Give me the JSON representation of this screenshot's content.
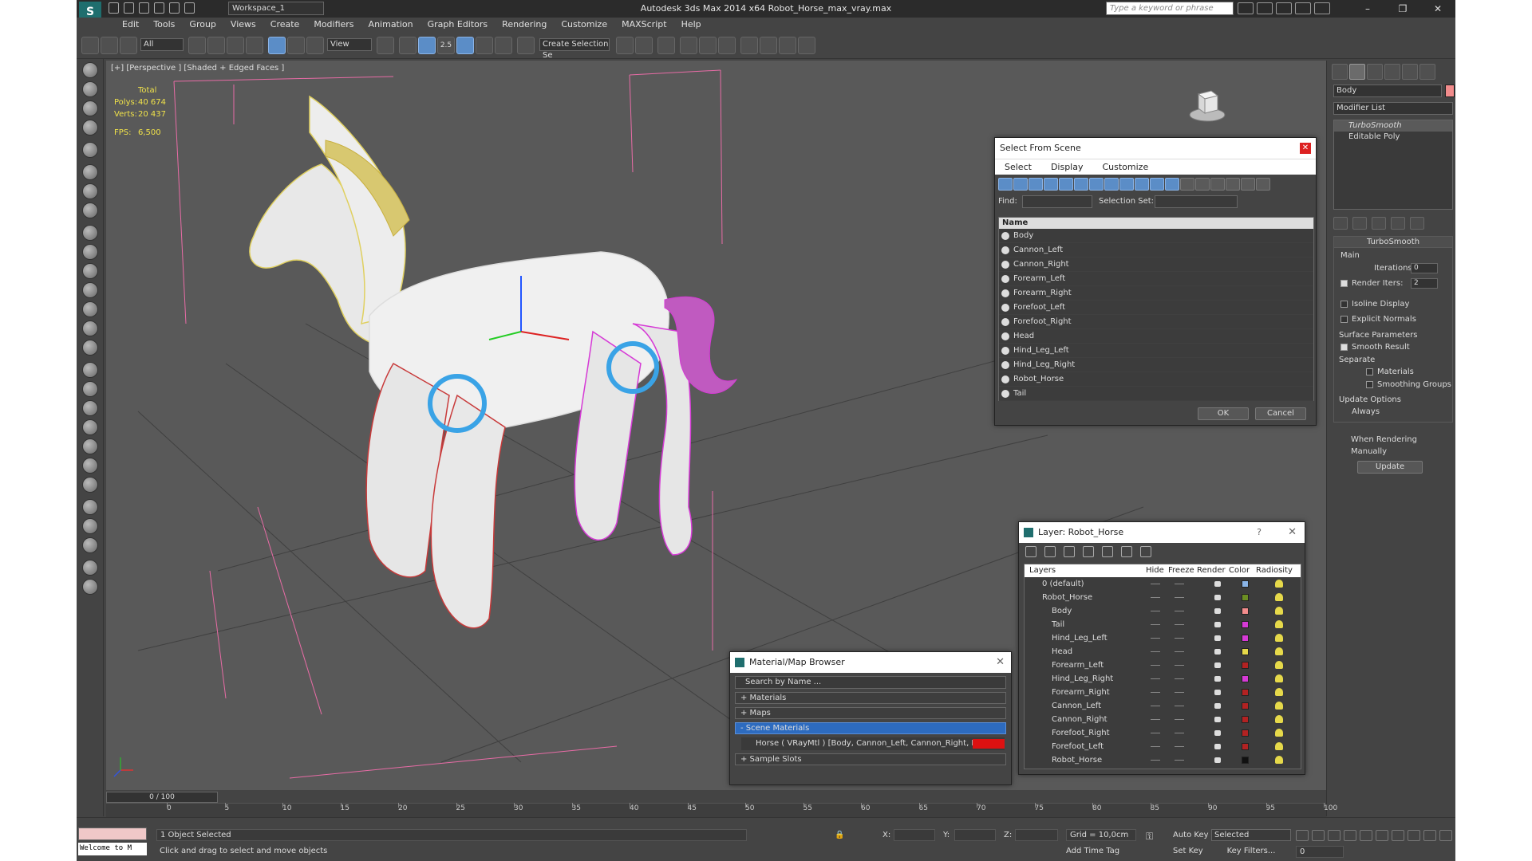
{
  "titlebar": {
    "workspace": "Workspace_1",
    "app_title": "Autodesk 3ds Max  2014 x64     Robot_Horse_max_vray.max",
    "search_placeholder": "Type a keyword or phrase",
    "minimize": "–",
    "maximize": "❐",
    "close": "✕"
  },
  "menu": [
    "Edit",
    "Tools",
    "Group",
    "Views",
    "Create",
    "Modifiers",
    "Animation",
    "Graph Editors",
    "Rendering",
    "Customize",
    "MAXScript",
    "Help"
  ],
  "toolbar": {
    "filter": "All",
    "refcoord": "View",
    "snap_label": "2.5",
    "selection_set": "Create Selection Se"
  },
  "viewport": {
    "label": "[+] [Perspective ] [Shaded + Edged Faces ]",
    "stats_total": "Total",
    "polys_label": "Polys:",
    "polys_value": "40 674",
    "verts_label": "Verts:",
    "verts_value": "20 437",
    "fps_label": "FPS:",
    "fps_value": "6,500"
  },
  "command_panel": {
    "object_name": "Body",
    "object_color": "#f28c8c",
    "modifier_list": "Modifier List",
    "stack": [
      "TurboSmooth",
      "Editable Poly"
    ],
    "turbosmooth": {
      "title": "TurboSmooth",
      "main": "Main",
      "iterations_label": "Iterations:",
      "iterations_value": "0",
      "render_iters_label": "Render Iters:",
      "render_iters_value": "2",
      "isoline": "Isoline Display",
      "explicit": "Explicit Normals",
      "surface_params": "Surface Parameters",
      "smooth_result": "Smooth Result",
      "separate": "Separate",
      "materials": "Materials",
      "smoothing_groups": "Smoothing Groups",
      "update_options": "Update Options",
      "always": "Always",
      "when_rendering": "When Rendering",
      "manually": "Manually",
      "update_btn": "Update"
    }
  },
  "select_from_scene": {
    "title": "Select From Scene",
    "menu": [
      "Select",
      "Display",
      "Customize"
    ],
    "find_label": "Find:",
    "selection_set_label": "Selection Set:",
    "name_header": "Name",
    "items": [
      "Body",
      "Cannon_Left",
      "Cannon_Right",
      "Forearm_Left",
      "Forearm_Right",
      "Forefoot_Left",
      "Forefoot_Right",
      "Head",
      "Hind_Leg_Left",
      "Hind_Leg_Right",
      "Robot_Horse",
      "Tail"
    ],
    "ok": "OK",
    "cancel": "Cancel"
  },
  "layer_dialog": {
    "title": "Layer: Robot_Horse",
    "help": "?",
    "headers": {
      "layers": "Layers",
      "hide": "Hide",
      "freeze": "Freeze",
      "render": "Render",
      "color": "Color",
      "radiosity": "Radiosity"
    },
    "rows": [
      {
        "name": "0 (default)",
        "indent": 1,
        "color": "#8ab4e6"
      },
      {
        "name": "Robot_Horse",
        "indent": 1,
        "color": "#6b8e23"
      },
      {
        "name": "Body",
        "indent": 2,
        "color": "#f28c8c"
      },
      {
        "name": "Tail",
        "indent": 2,
        "color": "#d63ad6"
      },
      {
        "name": "Hind_Leg_Left",
        "indent": 2,
        "color": "#d63ad6"
      },
      {
        "name": "Head",
        "indent": 2,
        "color": "#e6d94a"
      },
      {
        "name": "Forearm_Left",
        "indent": 2,
        "color": "#b22222"
      },
      {
        "name": "Hind_Leg_Right",
        "indent": 2,
        "color": "#d63ad6"
      },
      {
        "name": "Forearm_Right",
        "indent": 2,
        "color": "#b22222"
      },
      {
        "name": "Cannon_Left",
        "indent": 2,
        "color": "#b22222"
      },
      {
        "name": "Cannon_Right",
        "indent": 2,
        "color": "#b22222"
      },
      {
        "name": "Forefoot_Right",
        "indent": 2,
        "color": "#b22222"
      },
      {
        "name": "Forefoot_Left",
        "indent": 2,
        "color": "#b22222"
      },
      {
        "name": "Robot_Horse",
        "indent": 2,
        "color": "#111111"
      }
    ]
  },
  "material_browser": {
    "title": "Material/Map Browser",
    "search": "Search by Name ...",
    "materials": "+ Materials",
    "maps": "+ Maps",
    "scene_materials": "- Scene Materials",
    "horse_item": "Horse  ( VRayMtl ) [Body, Cannon_Left, Cannon_Right, Forearm...",
    "sample_slots": "+ Sample Slots"
  },
  "timeline": {
    "slider": "0 / 100",
    "ticks": [
      "0",
      "5",
      "10",
      "15",
      "20",
      "25",
      "30",
      "35",
      "40",
      "45",
      "50",
      "55",
      "60",
      "65",
      "70",
      "75",
      "80",
      "85",
      "90",
      "95",
      "100"
    ]
  },
  "status": {
    "welcome": "Welcome to M",
    "selected": "1 Object Selected",
    "prompt": "Click and drag to select and move objects",
    "x_label": "X:",
    "y_label": "Y:",
    "z_label": "Z:",
    "grid": "Grid = 10,0cm",
    "add_time_tag": "Add Time Tag",
    "auto_key": "Auto Key",
    "set_key": "Set Key",
    "selected_mode": "Selected",
    "key_filters": "Key Filters...",
    "frame": "0"
  }
}
